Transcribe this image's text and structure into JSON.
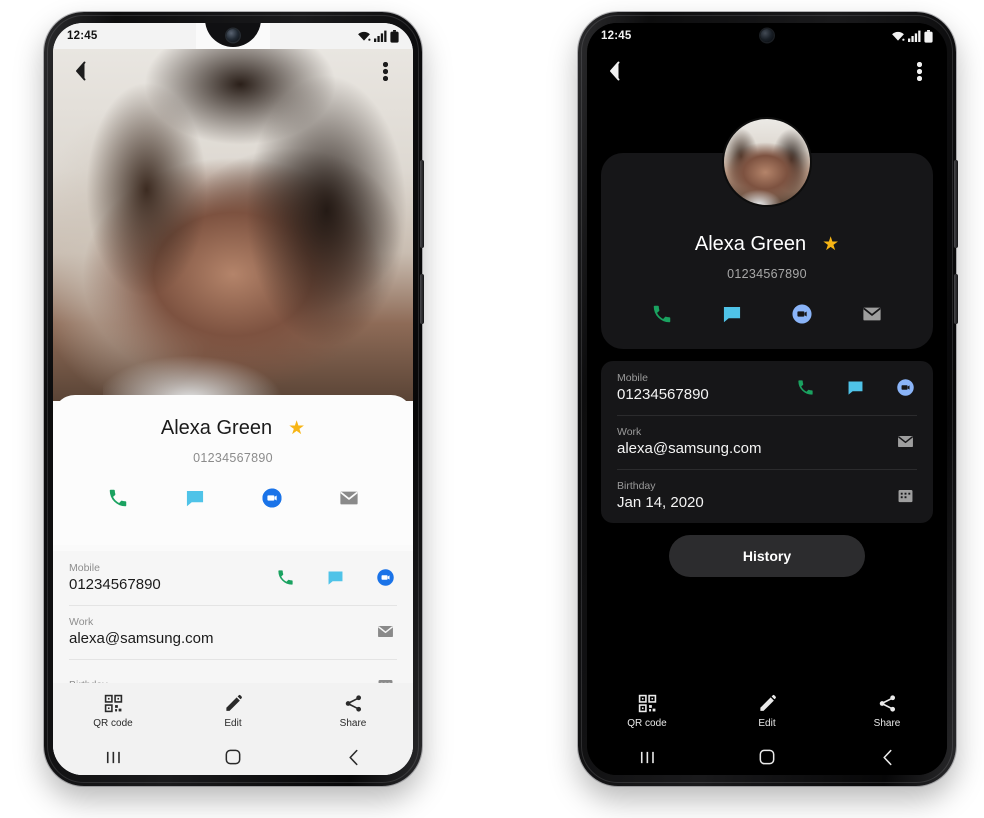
{
  "page": {
    "background_color": "#ffffff"
  },
  "phones": [
    {
      "id": "light",
      "theme": "light",
      "status_bar": {
        "time": "12:45",
        "wifi_icon": "wifi-icon",
        "signal_icon": "signal-bars-icon",
        "battery_icon": "battery-icon"
      },
      "app_bar": {
        "back_icon": "back-arrow-icon",
        "more_icon": "more-vertical-icon"
      },
      "hero": {
        "photo_alt": "contact-photo"
      },
      "contact": {
        "name": "Alexa Green",
        "phone": "01234567890",
        "favorite_icon": "star-icon",
        "favorite_color": "#f7b515",
        "actions": [
          {
            "name": "call-action",
            "icon": "phone-icon",
            "color": "#1aa260"
          },
          {
            "name": "message-action",
            "icon": "message-bubble-icon",
            "color": "#4fc3e8"
          },
          {
            "name": "video-call-action",
            "icon": "duo-video-icon",
            "color": "#1a73e8"
          },
          {
            "name": "email-action",
            "icon": "envelope-icon",
            "color": "#8a8a8a"
          }
        ]
      },
      "details": [
        {
          "label": "Mobile",
          "value": "01234567890",
          "icons": [
            {
              "name": "call-icon",
              "icon": "phone-icon",
              "color": "#1aa260"
            },
            {
              "name": "message-icon",
              "icon": "message-bubble-icon",
              "color": "#4fc3e8"
            },
            {
              "name": "video-call-icon",
              "icon": "duo-video-icon",
              "color": "#1a73e8"
            }
          ]
        },
        {
          "label": "Work",
          "value": "alexa@samsung.com",
          "icons": [
            {
              "name": "email-icon",
              "icon": "envelope-icon",
              "color": "#8a8a8a"
            }
          ]
        },
        {
          "label": "Birthday",
          "value": "",
          "icons": [
            {
              "name": "calendar-icon",
              "icon": "calendar-icon",
              "color": "#8a8a8a"
            }
          ]
        }
      ],
      "toolbar": [
        {
          "name": "qr-code-button",
          "label": "QR code",
          "icon": "qr-code-icon"
        },
        {
          "name": "edit-button",
          "label": "Edit",
          "icon": "pencil-icon"
        },
        {
          "name": "share-button",
          "label": "Share",
          "icon": "share-icon"
        }
      ],
      "navbar": [
        {
          "name": "recents-button",
          "icon": "recents-icon"
        },
        {
          "name": "home-button",
          "icon": "home-icon"
        },
        {
          "name": "back-button",
          "icon": "back-chevron-icon"
        }
      ]
    },
    {
      "id": "dark",
      "theme": "dark",
      "status_bar": {
        "time": "12:45",
        "wifi_icon": "wifi-icon",
        "signal_icon": "signal-bars-icon",
        "battery_icon": "battery-icon"
      },
      "app_bar": {
        "back_icon": "back-arrow-icon",
        "more_icon": "more-vertical-icon"
      },
      "contact": {
        "name": "Alexa Green",
        "phone": "01234567890",
        "favorite_icon": "star-icon",
        "favorite_color": "#f7b515",
        "avatar_alt": "contact-avatar",
        "actions": [
          {
            "name": "call-action",
            "icon": "phone-icon",
            "color": "#1aa260"
          },
          {
            "name": "message-action",
            "icon": "message-bubble-icon",
            "color": "#4fc3e8"
          },
          {
            "name": "video-call-action",
            "icon": "duo-video-icon",
            "color": "#8ab4f8"
          },
          {
            "name": "email-action",
            "icon": "envelope-icon",
            "color": "#9e9e9e"
          }
        ]
      },
      "details": [
        {
          "label": "Mobile",
          "value": "01234567890",
          "icons": [
            {
              "name": "call-icon",
              "icon": "phone-icon",
              "color": "#1aa260"
            },
            {
              "name": "message-icon",
              "icon": "message-bubble-icon",
              "color": "#4fc3e8"
            },
            {
              "name": "video-call-icon",
              "icon": "duo-video-icon",
              "color": "#8ab4f8"
            }
          ]
        },
        {
          "label": "Work",
          "value": "alexa@samsung.com",
          "icons": [
            {
              "name": "email-icon",
              "icon": "envelope-icon",
              "color": "#9e9e9e"
            }
          ]
        },
        {
          "label": "Birthday",
          "value": "Jan 14, 2020",
          "icons": [
            {
              "name": "calendar-icon",
              "icon": "calendar-icon",
              "color": "#9e9e9e"
            }
          ]
        }
      ],
      "history_button": {
        "label": "History"
      },
      "toolbar": [
        {
          "name": "qr-code-button",
          "label": "QR code",
          "icon": "qr-code-icon"
        },
        {
          "name": "edit-button",
          "label": "Edit",
          "icon": "pencil-icon"
        },
        {
          "name": "share-button",
          "label": "Share",
          "icon": "share-icon"
        }
      ],
      "navbar": [
        {
          "name": "recents-button",
          "icon": "recents-icon"
        },
        {
          "name": "home-button",
          "icon": "home-icon"
        },
        {
          "name": "back-button",
          "icon": "back-chevron-icon"
        }
      ]
    }
  ]
}
